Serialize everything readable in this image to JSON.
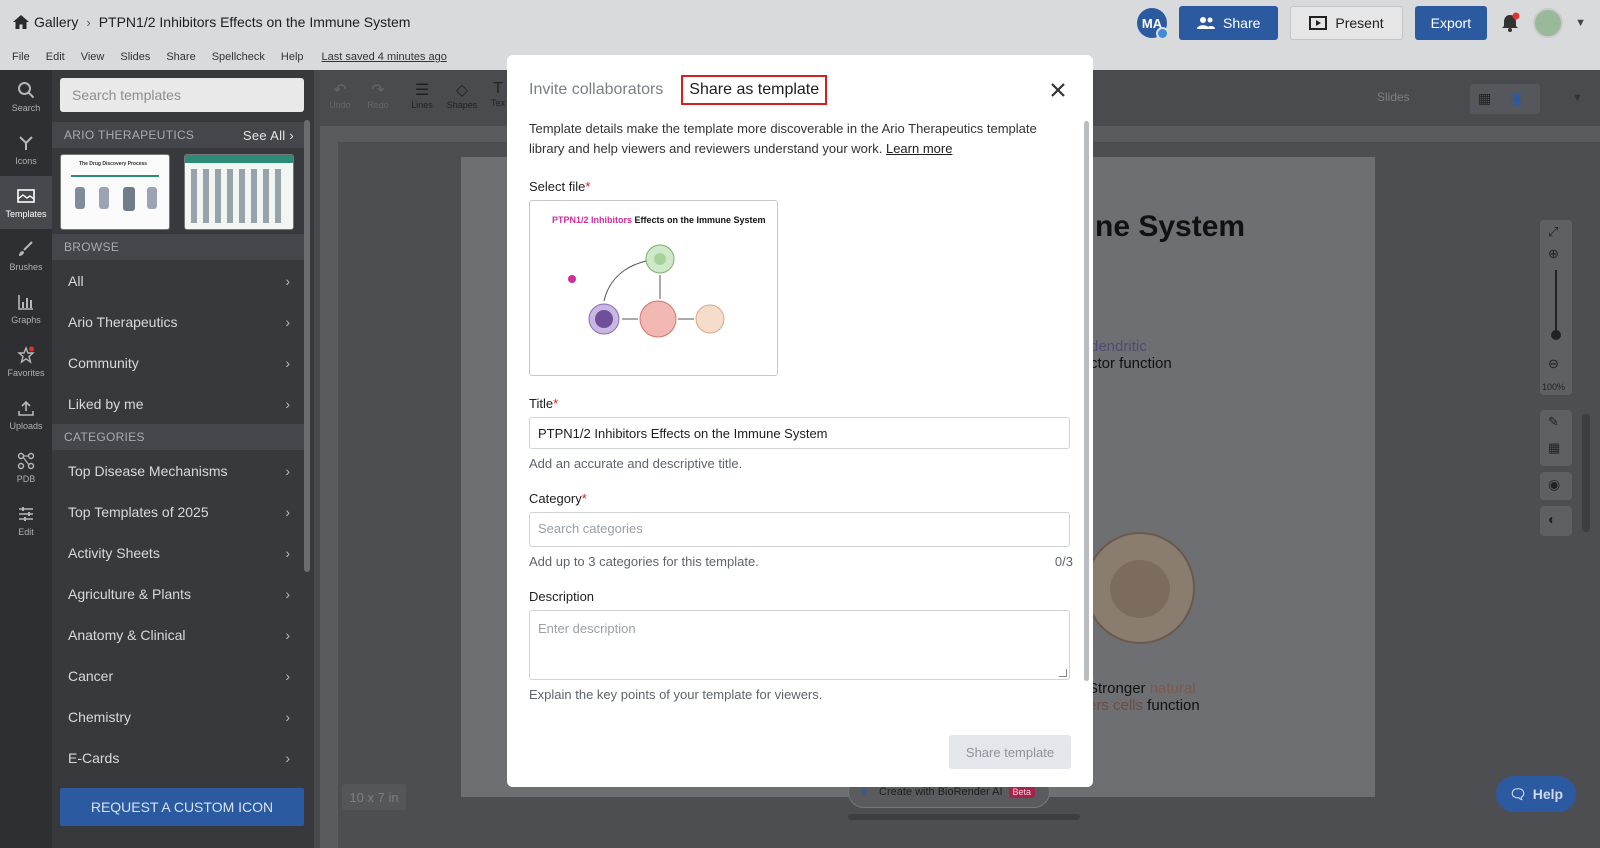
{
  "header": {
    "gallery_label": "Gallery",
    "doc_title": "PTPN1/2 Inhibitors Effects on the Immune System",
    "avatar_initials": "MA",
    "share_label": "Share",
    "present_label": "Present",
    "export_label": "Export"
  },
  "menu": {
    "items": [
      "File",
      "Edit",
      "View",
      "Slides",
      "Share",
      "Spellcheck",
      "Help"
    ],
    "last_saved": "Last saved 4 minutes ago"
  },
  "rail": {
    "items": [
      {
        "label": "Search",
        "icon": "search-icon"
      },
      {
        "label": "Icons",
        "icon": "icons-icon"
      },
      {
        "label": "Templates",
        "icon": "templates-icon"
      },
      {
        "label": "Brushes",
        "icon": "brush-icon"
      },
      {
        "label": "Graphs",
        "icon": "graph-icon"
      },
      {
        "label": "Favorites",
        "icon": "star-icon"
      },
      {
        "label": "Uploads",
        "icon": "upload-icon"
      },
      {
        "label": "PDB",
        "icon": "pdb-icon"
      },
      {
        "label": "Edit",
        "icon": "sliders-icon"
      }
    ]
  },
  "panel": {
    "search_placeholder": "Search templates",
    "org_section": "ARIO THERAPEUTICS",
    "see_all": "See All",
    "thumb1_title": "The Drug Discovery Process",
    "browse_header": "BROWSE",
    "browse_items": [
      "All",
      "Ario Therapeutics",
      "Community",
      "Liked by me"
    ],
    "categories_header": "CATEGORIES",
    "category_items": [
      "Top Disease Mechanisms",
      "Top Templates of 2025",
      "Activity Sheets",
      "Agriculture & Plants",
      "Anatomy & Clinical",
      "Cancer",
      "Chemistry",
      "E-Cards"
    ],
    "custom_button": "REQUEST A CUSTOM ICON"
  },
  "toolbar": {
    "undo": "Undo",
    "redo": "Redo",
    "lines": "Lines",
    "shapes": "Shapes",
    "text": "Tex",
    "slides": "Slides"
  },
  "canvas": {
    "title_fragment": "mune System",
    "text1": "dendritic",
    "text2": "ctor function",
    "text3_a": "Stronger ",
    "text3_b": "natural",
    "text4_a": "ers cells",
    "text4_b": " function",
    "zoom_level": "100%",
    "page_size": "10 x 7 in",
    "ai_label": "Create with BioRender AI",
    "beta_label": "Beta",
    "help_label": "Help"
  },
  "modal": {
    "tab_invite": "Invite collaborators",
    "tab_share": "Share as template",
    "intro": "Template details make the template more discoverable in the Ario Therapeutics template library and help viewers and reviewers understand your work.",
    "learn_more": "Learn more",
    "select_file_label": "Select file",
    "preview_title_pink": "PTPN1/2 Inhibitors",
    "preview_title_rest": " Effects on the Immune System",
    "title_label": "Title",
    "title_value": "PTPN1/2 Inhibitors Effects on the Immune System",
    "title_hint": "Add an accurate and descriptive title.",
    "category_label": "Category",
    "category_placeholder": "Search categories",
    "category_hint": "Add up to 3 categories for this template.",
    "category_count": "0/3",
    "description_label": "Description",
    "description_placeholder": "Enter description",
    "description_hint": "Explain the key points of your template for viewers.",
    "share_button": "Share template"
  },
  "colors": {
    "brand_blue": "#2c5aa0",
    "highlight_red": "#d61f1f",
    "pink_accent": "#d22c9d"
  }
}
